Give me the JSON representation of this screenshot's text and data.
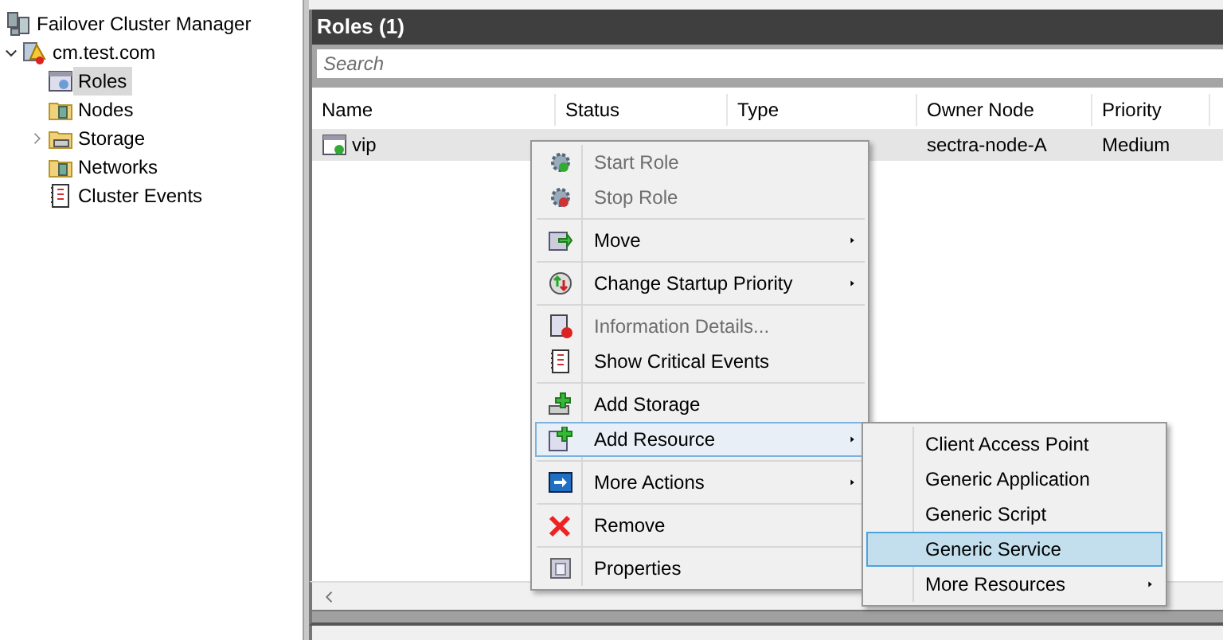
{
  "tree": {
    "label": "Failover Cluster Manager",
    "children": [
      {
        "label": "cm.test.com",
        "expanded": true,
        "children": [
          {
            "label": "Roles",
            "selected": true,
            "expandable": false
          },
          {
            "label": "Nodes",
            "selected": false,
            "expandable": false
          },
          {
            "label": "Storage",
            "selected": false,
            "expandable": true
          },
          {
            "label": "Networks",
            "selected": false,
            "expandable": false
          },
          {
            "label": "Cluster Events",
            "selected": false,
            "expandable": false
          }
        ]
      }
    ]
  },
  "panel": {
    "title": "Roles (1)",
    "search": {
      "placeholder": "Search"
    },
    "table": {
      "columns": [
        "Name",
        "Status",
        "Type",
        "Owner Node",
        "Priority"
      ],
      "rows": [
        {
          "selected": true,
          "cells": [
            "vip",
            "",
            "",
            "sectra-node-A",
            "Medium"
          ]
        }
      ]
    }
  },
  "context_menu": {
    "groups": [
      [
        {
          "label": "Start Role",
          "disabled": true,
          "submenu": false,
          "selected": false
        },
        {
          "label": "Stop Role",
          "disabled": true,
          "submenu": false,
          "selected": false
        }
      ],
      [
        {
          "label": "Move",
          "disabled": false,
          "submenu": true,
          "selected": false
        }
      ],
      [
        {
          "label": "Change Startup Priority",
          "disabled": false,
          "submenu": true,
          "selected": false
        }
      ],
      [
        {
          "label": "Information Details...",
          "disabled": true,
          "submenu": false,
          "selected": false
        },
        {
          "label": "Show Critical Events",
          "disabled": false,
          "submenu": false,
          "selected": false
        }
      ],
      [
        {
          "label": "Add Storage",
          "disabled": false,
          "submenu": false,
          "selected": false
        },
        {
          "label": "Add Resource",
          "disabled": false,
          "submenu": true,
          "selected": true
        }
      ],
      [
        {
          "label": "More Actions",
          "disabled": false,
          "submenu": true,
          "selected": false
        }
      ],
      [
        {
          "label": "Remove",
          "disabled": false,
          "submenu": false,
          "selected": false
        }
      ],
      [
        {
          "label": "Properties",
          "disabled": false,
          "submenu": false,
          "selected": false
        }
      ]
    ]
  },
  "submenu": {
    "items": [
      {
        "label": "Client Access Point",
        "submenu": false,
        "selected": false
      },
      {
        "label": "Generic Application",
        "submenu": false,
        "selected": false
      },
      {
        "label": "Generic Script",
        "submenu": false,
        "selected": false
      },
      {
        "label": "Generic Service",
        "submenu": false,
        "selected": true
      },
      {
        "label": "More Resources",
        "submenu": true,
        "selected": false
      }
    ]
  }
}
